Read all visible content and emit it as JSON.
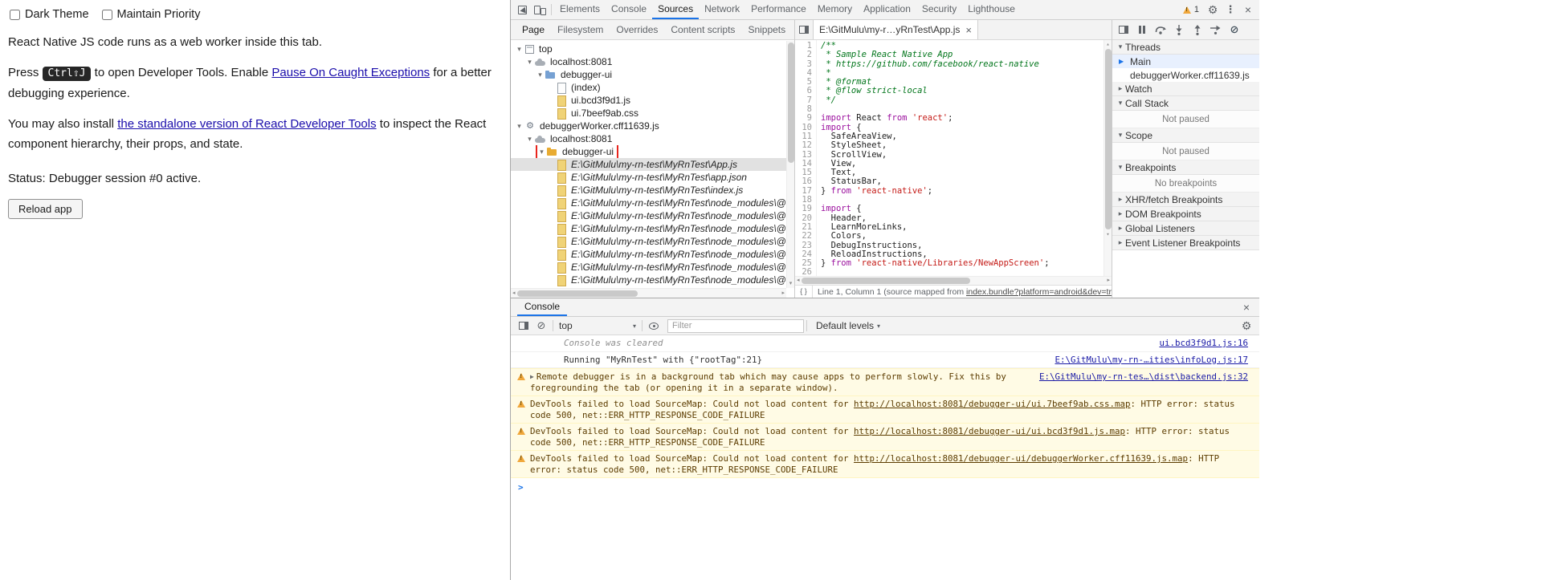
{
  "page": {
    "checkbox_dark_theme": "Dark Theme",
    "checkbox_maintain_priority": "Maintain Priority",
    "para1": "React Native JS code runs as a web worker inside this tab.",
    "para2": {
      "pre": "Press ",
      "kbd": "Ctrl⇧J",
      "mid": " to open Developer Tools. Enable ",
      "link": "Pause On Caught Exceptions",
      "post": " for a better debugging experience."
    },
    "para3": {
      "pre": "You may also install ",
      "link": "the standalone version of React Developer Tools",
      "post": " to inspect the React component hierarchy, their props, and state."
    },
    "status": "Status: Debugger session #0 active.",
    "reload_button": "Reload app"
  },
  "devtools": {
    "tabs": [
      "Elements",
      "Console",
      "Sources",
      "Network",
      "Performance",
      "Memory",
      "Application",
      "Security",
      "Lighthouse"
    ],
    "active_tab": "Sources",
    "warning_count": "1",
    "navigator": {
      "tabs": [
        "Page",
        "Filesystem",
        "Overrides",
        "Content scripts",
        "Snippets"
      ],
      "active_tab": "Page",
      "tree": [
        {
          "depth": 0,
          "exp": "▾",
          "icon": "frame",
          "label": "top"
        },
        {
          "depth": 1,
          "exp": "▾",
          "icon": "cloud",
          "label": "localhost:8081"
        },
        {
          "depth": 2,
          "exp": "▾",
          "icon": "folder-blue",
          "label": "debugger-ui"
        },
        {
          "depth": 3,
          "exp": "",
          "icon": "page-grey",
          "label": "(index)"
        },
        {
          "depth": 3,
          "exp": "",
          "icon": "page-yellow",
          "label": "ui.bcd3f9d1.js"
        },
        {
          "depth": 3,
          "exp": "",
          "icon": "page-yellow",
          "label": "ui.7beef9ab.css"
        },
        {
          "depth": 0,
          "exp": "▾",
          "icon": "worker",
          "label": "debuggerWorker.cff11639.js"
        },
        {
          "depth": 1,
          "exp": "▾",
          "icon": "cloud",
          "label": "localhost:8081"
        },
        {
          "depth": 2,
          "exp": "▾",
          "icon": "folder-yellow",
          "label": "debugger-ui",
          "annotated": true
        },
        {
          "depth": 3,
          "exp": "",
          "icon": "page-yellow",
          "label": "E:\\GitMulu\\my-rn-test\\MyRnTest\\App.js",
          "selected": true,
          "italic": true
        },
        {
          "depth": 3,
          "exp": "",
          "icon": "page-yellow",
          "label": "E:\\GitMulu\\my-rn-test\\MyRnTest\\app.json",
          "italic": true
        },
        {
          "depth": 3,
          "exp": "",
          "icon": "page-yellow",
          "label": "E:\\GitMulu\\my-rn-test\\MyRnTest\\index.js",
          "italic": true
        },
        {
          "depth": 3,
          "exp": "",
          "icon": "page-yellow",
          "label": "E:\\GitMulu\\my-rn-test\\MyRnTest\\node_modules\\@babel\\runtime\\hel",
          "italic": true
        },
        {
          "depth": 3,
          "exp": "",
          "icon": "page-yellow",
          "label": "E:\\GitMulu\\my-rn-test\\MyRnTest\\node_modules\\@babel\\runtime\\hel",
          "italic": true
        },
        {
          "depth": 3,
          "exp": "",
          "icon": "page-yellow",
          "label": "E:\\GitMulu\\my-rn-test\\MyRnTest\\node_modules\\@babel\\runtime\\hel",
          "italic": true
        },
        {
          "depth": 3,
          "exp": "",
          "icon": "page-yellow",
          "label": "E:\\GitMulu\\my-rn-test\\MyRnTest\\node_modules\\@babel\\runtime\\hel",
          "italic": true
        },
        {
          "depth": 3,
          "exp": "",
          "icon": "page-yellow",
          "label": "E:\\GitMulu\\my-rn-test\\MyRnTest\\node_modules\\@babel\\runtime\\hel",
          "italic": true
        },
        {
          "depth": 3,
          "exp": "",
          "icon": "page-yellow",
          "label": "E:\\GitMulu\\my-rn-test\\MyRnTest\\node_modules\\@babel\\runtime\\hel",
          "italic": true
        },
        {
          "depth": 3,
          "exp": "",
          "icon": "page-yellow",
          "label": "E:\\GitMulu\\my-rn-test\\MyRnTest\\node_modules\\@babel\\runtime\\hel",
          "italic": true
        }
      ]
    },
    "editor": {
      "tab": "E:\\GitMulu\\my-r…yRnTest\\App.js",
      "status_pre": "Line 1, Column 1 (source mapped from ",
      "status_link": "index.bundle?platform=android&dev=tru…",
      "lines": [
        [
          [
            "cm",
            "/**"
          ]
        ],
        [
          [
            "cm",
            " * Sample React Native App"
          ]
        ],
        [
          [
            "cm",
            " * https://github.com/facebook/react-native"
          ]
        ],
        [
          [
            "cm",
            " *"
          ]
        ],
        [
          [
            "cm",
            " * @format"
          ]
        ],
        [
          [
            "cm",
            " * @flow strict-local"
          ]
        ],
        [
          [
            "cm",
            " */"
          ]
        ],
        [],
        [
          [
            "kw",
            "import"
          ],
          [
            "pl",
            " React "
          ],
          [
            "kw",
            "from"
          ],
          [
            "pl",
            " "
          ],
          [
            "str",
            "'react'"
          ],
          [
            "pl",
            ";"
          ]
        ],
        [
          [
            "kw",
            "import"
          ],
          [
            "pl",
            " {"
          ]
        ],
        [
          [
            "pl",
            "  SafeAreaView,"
          ]
        ],
        [
          [
            "pl",
            "  StyleSheet,"
          ]
        ],
        [
          [
            "pl",
            "  ScrollView,"
          ]
        ],
        [
          [
            "pl",
            "  View,"
          ]
        ],
        [
          [
            "pl",
            "  Text,"
          ]
        ],
        [
          [
            "pl",
            "  StatusBar,"
          ]
        ],
        [
          [
            "pl",
            "} "
          ],
          [
            "kw",
            "from"
          ],
          [
            "pl",
            " "
          ],
          [
            "str",
            "'react-native'"
          ],
          [
            "pl",
            ";"
          ]
        ],
        [],
        [
          [
            "kw",
            "import"
          ],
          [
            "pl",
            " {"
          ]
        ],
        [
          [
            "pl",
            "  Header,"
          ]
        ],
        [
          [
            "pl",
            "  LearnMoreLinks,"
          ]
        ],
        [
          [
            "pl",
            "  Colors,"
          ]
        ],
        [
          [
            "pl",
            "  DebugInstructions,"
          ]
        ],
        [
          [
            "pl",
            "  ReloadInstructions,"
          ]
        ],
        [
          [
            "pl",
            "} "
          ],
          [
            "kw",
            "from"
          ],
          [
            "pl",
            " "
          ],
          [
            "str",
            "'react-native/Libraries/NewAppScreen'"
          ],
          [
            "pl",
            ";"
          ]
        ],
        []
      ]
    },
    "sidebar": {
      "sections": [
        {
          "label": "Threads",
          "expanded": true,
          "items": [
            {
              "label": "Main",
              "active": true
            },
            {
              "label": "debuggerWorker.cff11639.js"
            }
          ]
        },
        {
          "label": "Watch",
          "expanded": false
        },
        {
          "label": "Call Stack",
          "expanded": true,
          "info": "Not paused"
        },
        {
          "label": "Scope",
          "expanded": true,
          "info": "Not paused"
        },
        {
          "label": "Breakpoints",
          "expanded": true,
          "info": "No breakpoints"
        },
        {
          "label": "XHR/fetch Breakpoints",
          "expanded": false
        },
        {
          "label": "DOM Breakpoints",
          "expanded": false
        },
        {
          "label": "Global Listeners",
          "expanded": false
        },
        {
          "label": "Event Listener Breakpoints",
          "expanded": false
        }
      ]
    },
    "console": {
      "tab": "Console",
      "context": "top",
      "filter_placeholder": "Filter",
      "levels": "Default levels",
      "messages": [
        {
          "type": "info",
          "indent": true,
          "text": "Console was cleared",
          "source": "ui.bcd3f9d1.js:16"
        },
        {
          "type": "log",
          "indent": true,
          "text": "Running \"MyRnTest\" with {\"rootTag\":21}",
          "source": "E:\\GitMulu\\my-rn-…ities\\infoLog.js:17"
        },
        {
          "type": "warn",
          "expand": true,
          "text": "Remote debugger is in a background tab which may cause apps to perform slowly. Fix this by foregrounding the tab (or opening it in a separate window).",
          "source": "E:\\GitMulu\\my-rn-tes…\\dist\\backend.js:32"
        },
        {
          "type": "warn",
          "pre": "DevTools failed to load SourceMap: Could not load content for ",
          "link": "http://localhost:8081/debugger-ui/ui.7beef9ab.css.map",
          "post": ": HTTP error: status code 500, net::ERR_HTTP_RESPONSE_CODE_FAILURE"
        },
        {
          "type": "warn",
          "pre": "DevTools failed to load SourceMap: Could not load content for ",
          "link": "http://localhost:8081/debugger-ui/ui.bcd3f9d1.js.map",
          "post": ": HTTP error: status code 500, net::ERR_HTTP_RESPONSE_CODE_FAILURE"
        },
        {
          "type": "warn",
          "pre": "DevTools failed to load SourceMap: Could not load content for ",
          "link": "http://localhost:8081/debugger-ui/debuggerWorker.cff11639.js.map",
          "post": ": HTTP error: status code 500, net::ERR_HTTP_RESPONSE_CODE_FAILURE"
        }
      ]
    }
  }
}
